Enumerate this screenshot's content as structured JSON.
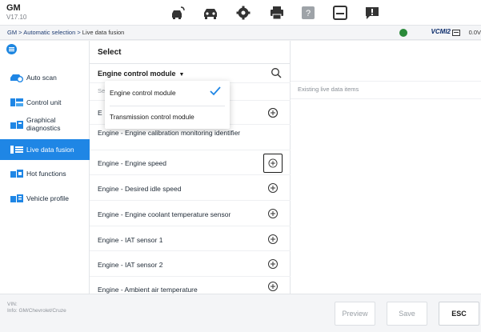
{
  "app": {
    "name": "GM",
    "version": "V17.10"
  },
  "toolbar_icons": [
    "car-connect-icon",
    "car-front-icon",
    "gear-icon",
    "printer-icon",
    "help-icon",
    "save-icon",
    "message-icon"
  ],
  "breadcrumb": {
    "path": "GM > Automatic selection > ",
    "current": "Live data fusion"
  },
  "status": {
    "vcmi": "VCMI2",
    "voltage": "0.0V"
  },
  "sidebar": {
    "items": [
      {
        "label": "Auto scan",
        "icon": "auto-scan-icon"
      },
      {
        "label": "Control unit",
        "icon": "control-unit-icon"
      },
      {
        "label": "Graphical diagnostics",
        "icon": "graphical-diagnostics-icon"
      },
      {
        "label": "Live data fusion",
        "icon": "live-data-icon",
        "active": true
      },
      {
        "label": "Hot functions",
        "icon": "hot-functions-icon"
      },
      {
        "label": "Vehicle profile",
        "icon": "vehicle-profile-icon"
      }
    ]
  },
  "main": {
    "title": "Select",
    "dropdown_value": "Engine control module",
    "sub_text": "Se",
    "rows": [
      {
        "label": "E"
      },
      {
        "label": "Engine - Engine calibration monitoring identifier"
      },
      {
        "label": "Engine - Engine speed"
      },
      {
        "label": "Engine - Desired idle speed"
      },
      {
        "label": "Engine - Engine coolant temperature sensor"
      },
      {
        "label": "Engine - IAT sensor 1"
      },
      {
        "label": "Engine - IAT sensor 2"
      },
      {
        "label": "Engine - Ambient air temperature"
      }
    ]
  },
  "popup": {
    "options": [
      {
        "label": "Engine control module",
        "selected": true
      },
      {
        "label": "Transmission control module",
        "selected": false
      }
    ]
  },
  "right_panel": {
    "label": "Existing live data items"
  },
  "footer": {
    "vin": "VIN:",
    "info": "Info: GM/Chevrolet/Cruze",
    "buttons": {
      "preview": "Preview",
      "save": "Save",
      "esc": "ESC"
    }
  },
  "colors": {
    "accent": "#1f86e5",
    "brand_dark": "#0b2c6b"
  }
}
